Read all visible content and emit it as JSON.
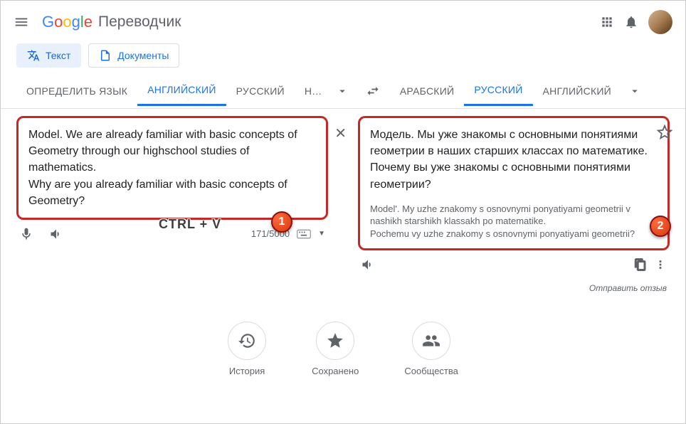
{
  "header": {
    "title": "Переводчик"
  },
  "modes": {
    "text": "Текст",
    "docs": "Документы"
  },
  "lang_source": {
    "detect": "ОПРЕДЕЛИТЬ ЯЗЫК",
    "tabs": [
      "АНГЛИЙСКИЙ",
      "РУССКИЙ",
      "НЕМЕ"
    ]
  },
  "lang_target": {
    "tabs": [
      "АРАБСКИЙ",
      "РУССКИЙ",
      "АНГЛИЙСКИЙ"
    ]
  },
  "source": {
    "text": "Model. We are already familiar with basic concepts of Geometry through our highschool studies of mathematics.\nWhy are you already familiar with basic concepts of Geometry?",
    "count": "171/5000"
  },
  "target": {
    "text": "Модель. Мы уже знакомы с основными понятиями геометрии в наших старших классах по математике. Почему вы уже знакомы с основными понятиями геометрии?",
    "translit": "Model'. My uzhe znakomy s osnovnymi ponyatiyami geometrii v nashikh starshikh klassakh po matematike.\nPochemu vy uzhe znakomy s osnovnymi ponyatiyami geometrii?"
  },
  "feedback": "Отправить отзыв",
  "bottom": {
    "history": "История",
    "saved": "Сохранено",
    "community": "Сообщества"
  },
  "annotation": {
    "hint": "CTRL + V",
    "badge1": "1",
    "badge2": "2"
  }
}
